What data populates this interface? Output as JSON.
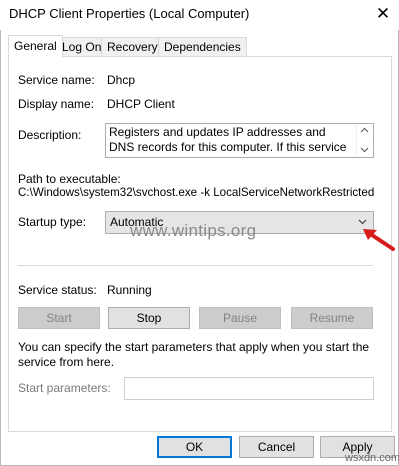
{
  "window": {
    "title": "DHCP Client Properties (Local Computer)",
    "close_glyph": "✕"
  },
  "tabs": [
    {
      "label": "General",
      "active": true
    },
    {
      "label": "Log On",
      "active": false
    },
    {
      "label": "Recovery",
      "active": false
    },
    {
      "label": "Dependencies",
      "active": false
    }
  ],
  "general": {
    "service_name_label": "Service name:",
    "service_name_value": "Dhcp",
    "display_name_label": "Display name:",
    "display_name_value": "DHCP Client",
    "description_label": "Description:",
    "description_value": "Registers and updates IP addresses and DNS records for this computer. If this service is stopped,",
    "path_label": "Path to executable:",
    "path_value": "C:\\Windows\\system32\\svchost.exe -k LocalServiceNetworkRestricted",
    "startup_type_label": "Startup type:",
    "startup_type_value": "Automatic",
    "service_status_label": "Service status:",
    "service_status_value": "Running",
    "buttons": {
      "start": "Start",
      "stop": "Stop",
      "pause": "Pause",
      "resume": "Resume"
    },
    "params_hint": "You can specify the start parameters that apply when you start the service from here.",
    "start_params_label": "Start parameters:",
    "start_params_value": ""
  },
  "footer": {
    "ok": "OK",
    "cancel": "Cancel",
    "apply": "Apply"
  },
  "watermark": "www.wintips.org",
  "watermark_corner": "wsxdn.com",
  "colors": {
    "arrow": "#d81c1c",
    "focus": "#0078d7"
  },
  "icons": [
    "close-icon",
    "scroll-up-icon",
    "scroll-down-icon",
    "chevron-down-icon",
    "red-arrow-icon"
  ]
}
